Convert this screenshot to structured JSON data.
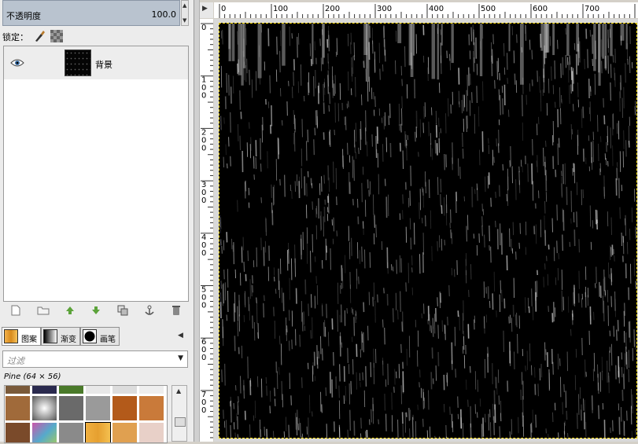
{
  "layers_panel": {
    "opacity_label": "不透明度",
    "opacity_value": "100.0",
    "lock_label": "锁定：",
    "layers": [
      {
        "name": "背景",
        "visible": true
      }
    ]
  },
  "tabs": [
    {
      "label": "图案"
    },
    {
      "label": "渐变"
    },
    {
      "label": "画笔"
    }
  ],
  "patterns": {
    "filter_placeholder": "过滤",
    "selected_name": "Pine (64 × 56)"
  },
  "rulers": {
    "horizontal_ticks": [
      "0",
      "100",
      "200",
      "300",
      "400",
      "500",
      "600",
      "700"
    ],
    "vertical_ticks": [
      "0",
      "100",
      "200",
      "300",
      "400",
      "500",
      "600",
      "700"
    ]
  },
  "colors": {
    "canvas_bg": "#000000",
    "selection_border": "#ffe100",
    "opacity_fill": "#b9c3cf"
  }
}
